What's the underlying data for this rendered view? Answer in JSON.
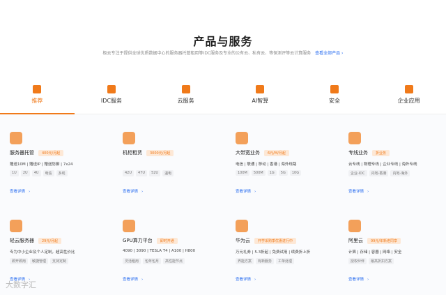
{
  "section": {
    "title": "产品与服务",
    "subtitle": "极云专注于提供全球优质数据中心的服务器托管租用等IDC服务及专业的公有云、私有云、等保测评等云计算服务",
    "more_link": "查看全部产品 ›"
  },
  "tabs": [
    {
      "label": "推荐",
      "icon": "recommend-box-icon",
      "active": true
    },
    {
      "label": "IDC服务",
      "icon": "server-rack-icon",
      "active": false
    },
    {
      "label": "云服务",
      "icon": "cloud-document-icon",
      "active": false
    },
    {
      "label": "AI智算",
      "icon": "ai-chip-icon",
      "active": false
    },
    {
      "label": "安全",
      "icon": "shield-check-icon",
      "active": false
    },
    {
      "label": "企业应用",
      "icon": "apps-grid-icon",
      "active": false
    }
  ],
  "cards": [
    {
      "name": "服务器托管",
      "price": "400元/月起",
      "desc": "赠送10M | 赠送IP | 赠送防御 | 7x24",
      "tags": [
        "1U",
        "2U",
        "4U",
        "电信",
        "多线"
      ],
      "link": "查看详情",
      "icon": "server-hosting-icon"
    },
    {
      "name": "机柜租赁",
      "price": "3000元/月起",
      "desc": "",
      "tags": [
        "42U",
        "47U",
        "52U",
        "温电"
      ],
      "link": "查看详情",
      "icon": "cabinet-icon"
    },
    {
      "name": "大带宽业务",
      "price": "6元/M/月起",
      "desc": "电信 | 联通 | 移动 | 香港 | 海外线路",
      "tags": [
        "100M",
        "500M",
        "1G",
        "5G",
        "10G"
      ],
      "link": "查看详情",
      "icon": "bandwidth-icon"
    },
    {
      "name": "专线业务",
      "price": "折业务",
      "desc": "云专线 | 物理专线 | 企业专线 | 海外专线",
      "tags": [
        "企业-IDC",
        "内地-香港",
        "内地-海外"
      ],
      "link": "查看详情",
      "icon": "leased-line-icon"
    },
    {
      "name": "轻云服务器",
      "price": "29元/月起",
      "desc": "专为中小企业及个人定制，超高性价比",
      "tags": [
        "即开即用",
        "敏捷管理",
        "支持定制"
      ],
      "link": "查看详情",
      "icon": "light-cloud-server-icon"
    },
    {
      "name": "GPU算力平台",
      "price": "即时开通",
      "desc": "4090 | 3090 | TESLA T4 | A100 | H800",
      "tags": [
        "灵活租用",
        "包年包月",
        "高性能节点"
      ],
      "link": "查看详情",
      "icon": "gpu-icon"
    },
    {
      "name": "华为云",
      "price": "开学采购季优惠进行中",
      "desc": "万元礼券 | 5.3折起 | 免费试用 | 续费折上折",
      "tags": [
        "界能方案",
        "有新服务",
        "工单处理"
      ],
      "link": "查看详情",
      "icon": "huawei-cloud-icon"
    },
    {
      "name": "阿里云",
      "price": "99元/年新老同享",
      "desc": "计算 | 存储 | 容器 | 网络 | 安全",
      "tags": [
        "授权伙伴",
        "最高折扣方案"
      ],
      "link": "查看详情",
      "icon": "aliyun-icon"
    }
  ],
  "watermark": "大数字汇",
  "colors": {
    "accent": "#f07a1a",
    "link": "#2a6ef0"
  }
}
